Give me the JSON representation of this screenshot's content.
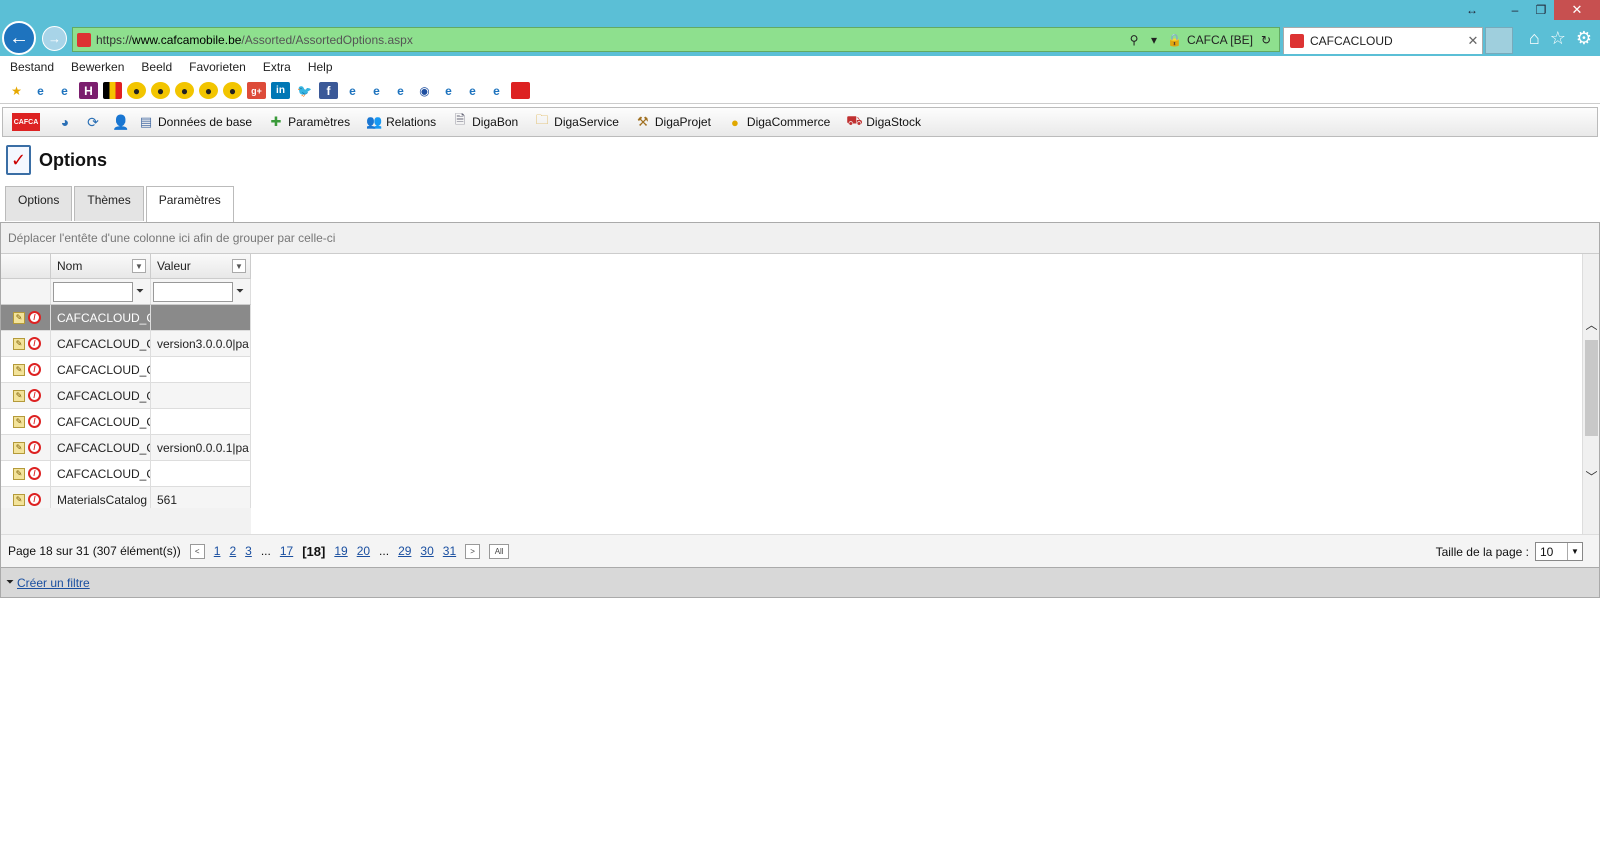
{
  "browser": {
    "url_scheme": "https://",
    "url_domain": "www.cafcamobile.be",
    "url_path": "/Assorted/AssortedOptions.aspx",
    "security_label": "CAFCA [BE]",
    "tab_title": "CAFCACLOUD"
  },
  "menu": [
    "Bestand",
    "Bewerken",
    "Beeld",
    "Favorieten",
    "Extra",
    "Help"
  ],
  "app_menu": {
    "logo_text": "CAFCA",
    "items": [
      "Données de base",
      "Paramètres",
      "Relations",
      "DigaBon",
      "DigaService",
      "DigaProjet",
      "DigaCommerce",
      "DigaStock"
    ]
  },
  "page": {
    "title": "Options"
  },
  "tabs": [
    "Options",
    "Thèmes",
    "Paramètres"
  ],
  "grid": {
    "group_hint": "Déplacer l'entête d'une colonne ici afin de grouper par celle-ci",
    "columns": [
      "Nom",
      "Valeur"
    ],
    "rows": [
      {
        "nom": "CAFCACLOUD_GR",
        "valeur": ""
      },
      {
        "nom": "CAFCACLOUD_GR",
        "valeur": "version3.0.0.0|pa"
      },
      {
        "nom": "CAFCACLOUD_GR",
        "valeur": ""
      },
      {
        "nom": "CAFCACLOUD_GR",
        "valeur": ""
      },
      {
        "nom": "CAFCACLOUD_GR",
        "valeur": ""
      },
      {
        "nom": "CAFCACLOUD_GR",
        "valeur": "version0.0.0.1|pa"
      },
      {
        "nom": "CAFCACLOUD_GR",
        "valeur": ""
      },
      {
        "nom": "MaterialsCatalog",
        "valeur": "561"
      }
    ]
  },
  "pager": {
    "summary": "Page 18 sur 31 (307 élément(s))",
    "pages_before": [
      "1",
      "2",
      "3"
    ],
    "ellipsis": "...",
    "page_prev": "17",
    "current": "[18]",
    "pages_after": [
      "19",
      "20"
    ],
    "pages_end": [
      "29",
      "30",
      "31"
    ],
    "all_label": "All",
    "page_size_label": "Taille de la page :",
    "page_size_value": "10"
  },
  "filter_link": "Créer un filtre"
}
